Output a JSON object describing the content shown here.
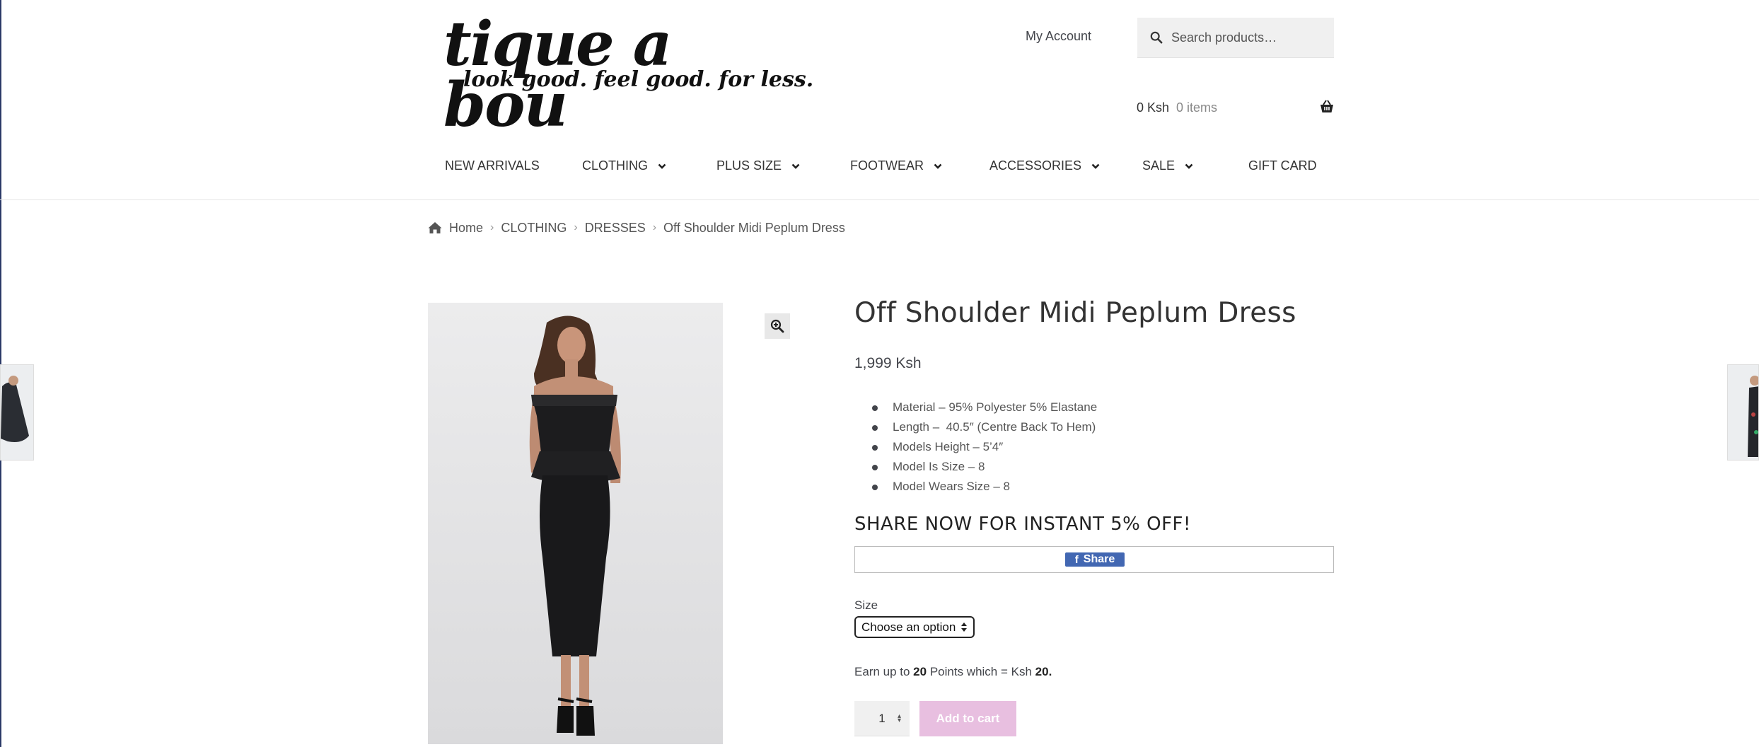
{
  "header": {
    "logo_main": "tique a bou",
    "logo_tagline": "look good. feel good. for less.",
    "my_account": "My Account",
    "search_placeholder": "Search products…",
    "cart_amount": "0 Ksh",
    "cart_items": "0 items"
  },
  "nav": [
    {
      "label": "NEW ARRIVALS",
      "dropdown": false
    },
    {
      "label": "CLOTHING",
      "dropdown": true
    },
    {
      "label": "PLUS SIZE",
      "dropdown": true
    },
    {
      "label": "FOOTWEAR",
      "dropdown": true
    },
    {
      "label": "ACCESSORIES",
      "dropdown": true
    },
    {
      "label": "SALE",
      "dropdown": true
    },
    {
      "label": "GIFT CARD",
      "dropdown": false
    }
  ],
  "breadcrumb": [
    "Home",
    "CLOTHING",
    "DRESSES",
    "Off Shoulder Midi Peplum Dress"
  ],
  "product": {
    "title": "Off Shoulder Midi Peplum Dress",
    "price": "1,999 Ksh",
    "specs": [
      "Material – 95% Polyester 5% Elastane",
      "Length –  40.5″ (Centre Back To Hem)",
      "Models Height – 5’4″",
      "Model Is Size – 8",
      "Model Wears Size – 8"
    ],
    "share_heading": "SHARE NOW FOR INSTANT 5% OFF!",
    "share_button": "Share",
    "size_label": "Size",
    "size_select": "Choose an option",
    "points_prefix": "Earn up to ",
    "points_value": "20",
    "points_mid": " Points which = Ksh ",
    "points_money": "20.",
    "quantity": "1",
    "add_to_cart": "Add to cart"
  },
  "colors": {
    "add_to_cart_bg": "#e8bfe0",
    "facebook_blue": "#4267b2"
  }
}
